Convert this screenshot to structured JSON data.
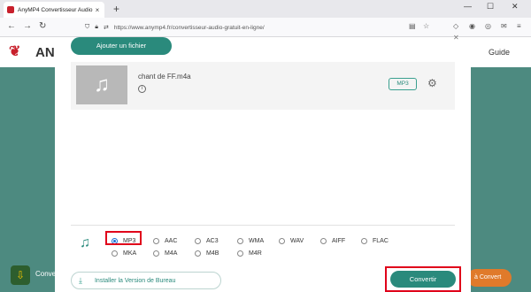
{
  "browser": {
    "tab_title": "AnyMP4 Convertisseur Audio G",
    "tab_close": "×",
    "new_tab": "+",
    "url": "https://www.anymp4.fr/convertisseur-audio-gratuit-en-ligne/",
    "win_minimize": "—",
    "win_maximize": "☐",
    "win_close": "✕"
  },
  "site": {
    "logo_text": "AN",
    "guide_label": "Guide",
    "left_label": "Conve",
    "right_label": "à Convert"
  },
  "modal": {
    "add_file_label": "Ajouter un fichier",
    "file": {
      "name": "chant de FF.m4a",
      "format": "MP3"
    },
    "formats": [
      "MP3",
      "AAC",
      "AC3",
      "WMA",
      "WAV",
      "AIFF",
      "FLAC",
      "MKA",
      "M4A",
      "M4B",
      "M4R"
    ],
    "selected_format": "MP3",
    "install_label": "Installer la Version de Bureau",
    "convert_label": "Convertir"
  },
  "colors": {
    "accent": "#2a8a7c",
    "highlight": "#e0001a",
    "radio_selected": "#1c6fd6"
  }
}
